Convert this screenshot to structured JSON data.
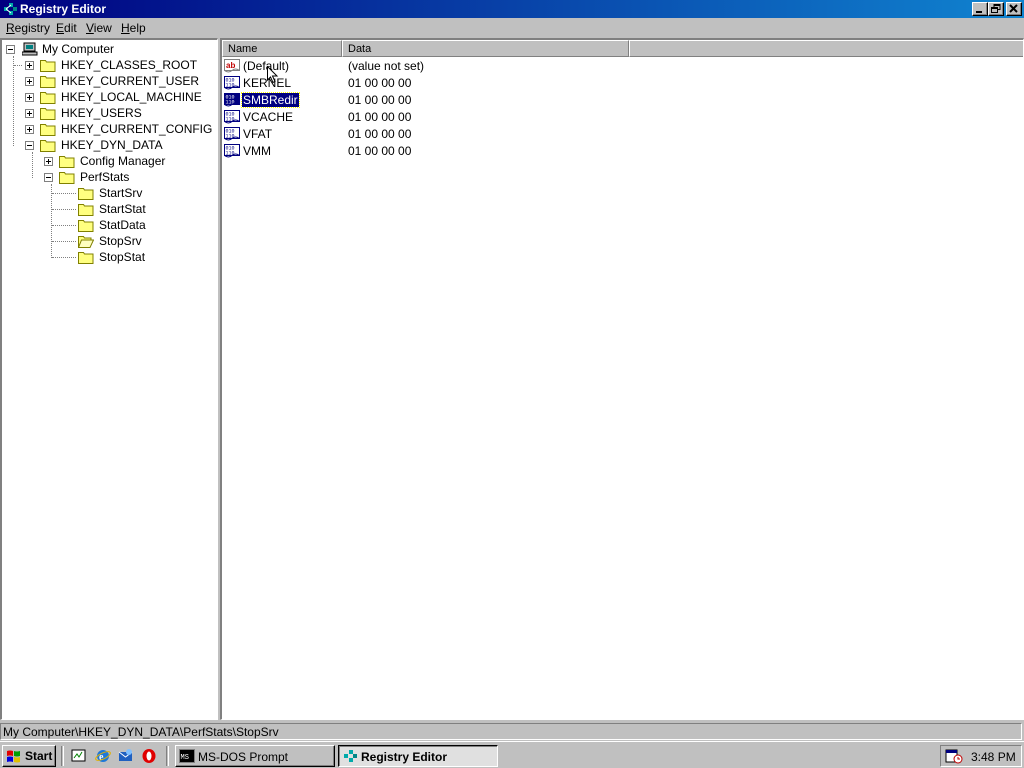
{
  "window": {
    "title": "Registry Editor"
  },
  "menu": [
    {
      "label": "Registry",
      "accel": "R",
      "rest": "egistry"
    },
    {
      "label": "Edit",
      "accel": "E",
      "rest": "dit"
    },
    {
      "label": "View",
      "accel": "V",
      "rest": "iew"
    },
    {
      "label": "Help",
      "accel": "H",
      "rest": "elp"
    }
  ],
  "tree": {
    "root": "My Computer",
    "hives": [
      "HKEY_CLASSES_ROOT",
      "HKEY_CURRENT_USER",
      "HKEY_LOCAL_MACHINE",
      "HKEY_USERS",
      "HKEY_CURRENT_CONFIG",
      "HKEY_DYN_DATA"
    ],
    "dyn_children": [
      "Config Manager",
      "PerfStats"
    ],
    "perfstats_children": [
      "StartSrv",
      "StartStat",
      "StatData",
      "StopSrv",
      "StopStat"
    ],
    "selected": "StopSrv"
  },
  "list": {
    "columns": [
      "Name",
      "Data"
    ],
    "rows": [
      {
        "name": "(Default)",
        "data": "(value not set)",
        "icon": "string-value-icon"
      },
      {
        "name": "KERNEL",
        "data": "01 00 00 00",
        "icon": "binary-value-icon"
      },
      {
        "name": "SMBRedir",
        "data": "01 00 00 00",
        "icon": "binary-value-icon"
      },
      {
        "name": "VCACHE",
        "data": "01 00 00 00",
        "icon": "binary-value-icon"
      },
      {
        "name": "VFAT",
        "data": "01 00 00 00",
        "icon": "binary-value-icon"
      },
      {
        "name": "VMM",
        "data": "01 00 00 00",
        "icon": "binary-value-icon"
      }
    ],
    "selected": "SMBRedir"
  },
  "status": {
    "path": "My Computer\\HKEY_DYN_DATA\\PerfStats\\StopSrv"
  },
  "taskbar": {
    "start": "Start",
    "quick_launch": [
      "show-desktop-icon",
      "internet-explorer-icon",
      "outlook-express-icon",
      "opera-icon"
    ],
    "tasks": [
      {
        "label": "MS-DOS Prompt",
        "active": false
      },
      {
        "label": "Registry Editor",
        "active": true
      }
    ],
    "clock": "3:48 PM"
  },
  "colors": {
    "titlebar_start": "#000080",
    "titlebar_end": "#1084d0",
    "selection": "#000080",
    "face": "#c0c0c0"
  }
}
